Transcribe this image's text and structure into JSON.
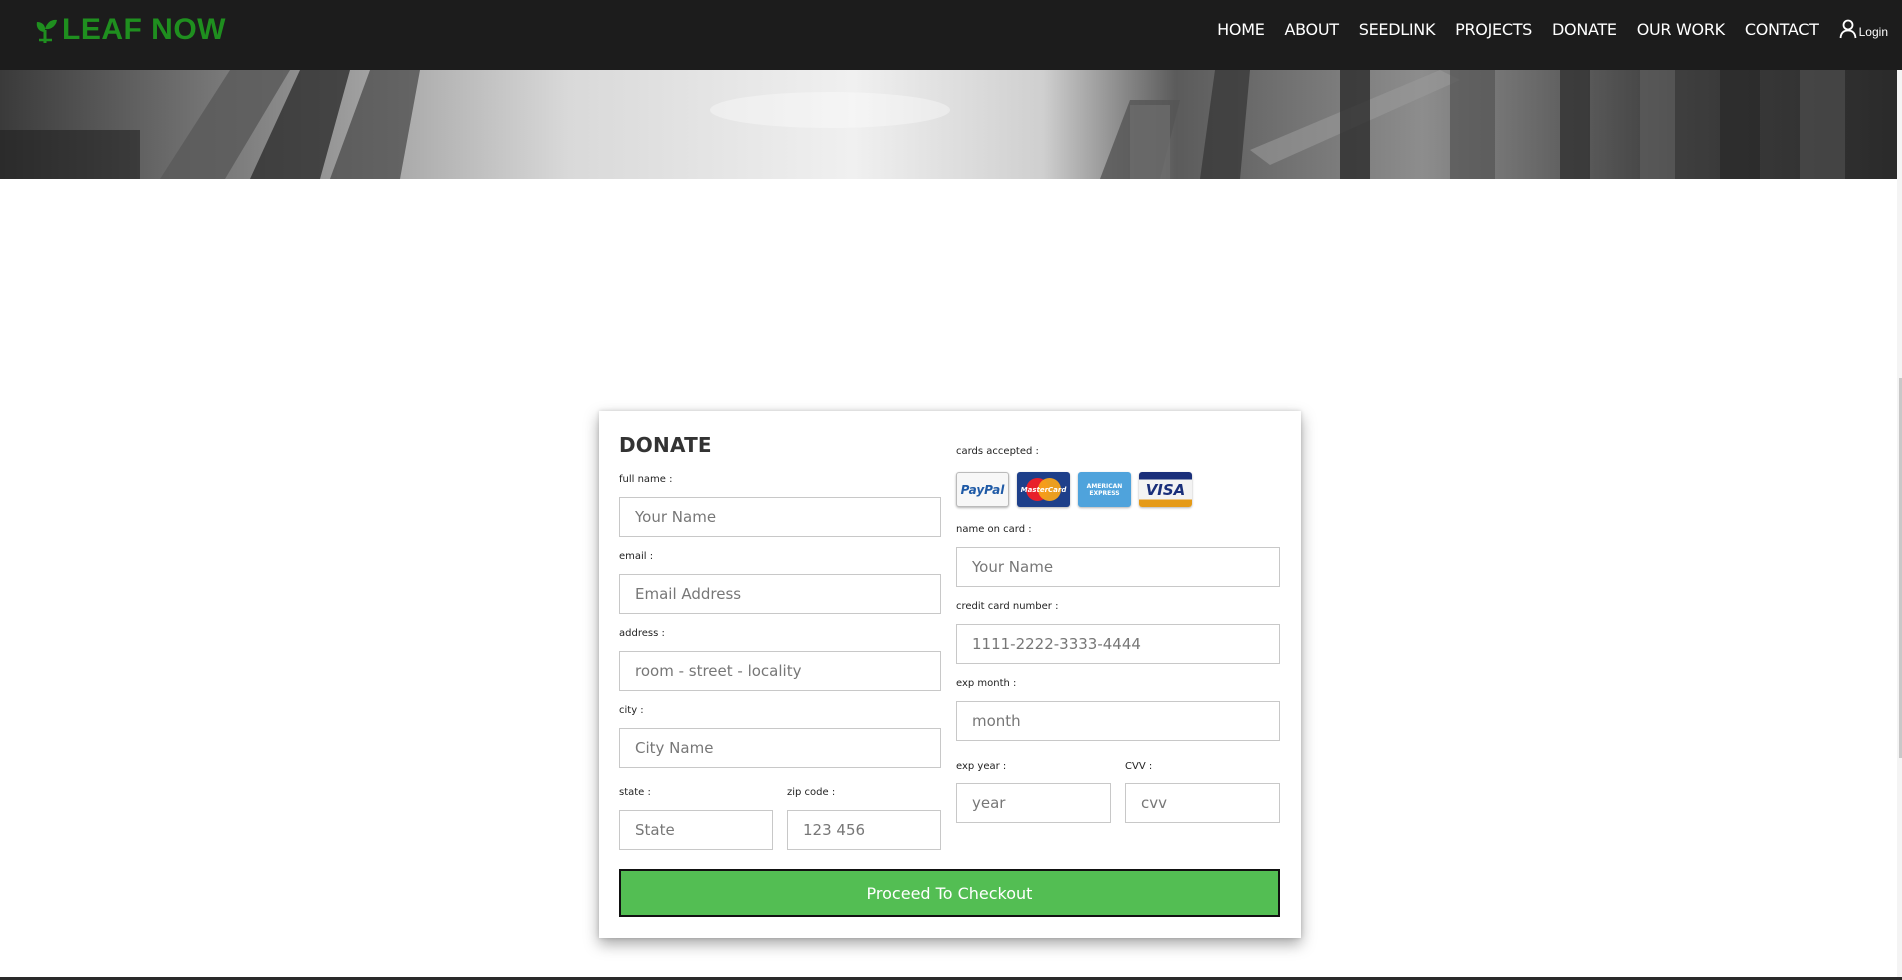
{
  "brand": {
    "name": "LEAF NOW",
    "color": "#1f8f1f",
    "icon": "leaf-sprout-icon"
  },
  "nav": {
    "items": [
      "HOME",
      "ABOUT",
      "SEEDLINK",
      "PROJECTS",
      "DONATE",
      "OUR WORK",
      "CONTACT"
    ],
    "login": "Login",
    "login_icon": "user-icon"
  },
  "form": {
    "title": "DONATE",
    "full_name": {
      "label": "full name :",
      "placeholder": "Your Name"
    },
    "email": {
      "label": "email :",
      "placeholder": "Email Address"
    },
    "address": {
      "label": "address :",
      "placeholder": "room - street - locality"
    },
    "city": {
      "label": "city :",
      "placeholder": "City Name"
    },
    "state": {
      "label": "state :",
      "placeholder": "State"
    },
    "zip": {
      "label": "zip code :",
      "placeholder": "123 456"
    },
    "cards_accepted": {
      "label": "cards accepted :",
      "cards": [
        "PayPal",
        "MasterCard",
        "AMERICAN EXPRESS",
        "VISA"
      ]
    },
    "name_on_card": {
      "label": "name on card :",
      "placeholder": "Your Name"
    },
    "card_number": {
      "label": "credit card number :",
      "placeholder": "1111-2222-3333-4444"
    },
    "exp_month": {
      "label": "exp month :",
      "placeholder": "month"
    },
    "exp_year": {
      "label": "exp year :",
      "placeholder": "year"
    },
    "cvv": {
      "label": "CVV :",
      "placeholder": "cvv"
    },
    "submit": "Proceed To Checkout",
    "submit_color": "#53be53"
  }
}
